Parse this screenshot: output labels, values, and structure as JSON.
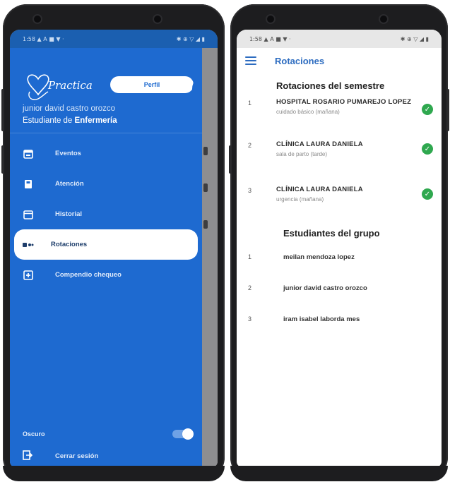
{
  "left_phone": {
    "status": {
      "time": "1:58",
      "icons_left": "▲ A ■ ▼ ·",
      "icons_right": "✱ ⊕ ▽ ◢ ▮"
    },
    "brand": "Practica",
    "profile_button": "Perfil",
    "close_icon": "✕",
    "user": {
      "name": "junior david castro orozco",
      "role_prefix": "Estudiante de",
      "role_area": "Enfermería"
    },
    "menu": [
      {
        "label": "Eventos",
        "icon": "calendar-card-icon"
      },
      {
        "label": "Atención",
        "icon": "clipboard-icon"
      },
      {
        "label": "Historial",
        "icon": "calendar-icon"
      },
      {
        "label": "Rotaciones",
        "icon": "rotation-icon",
        "active": true
      },
      {
        "label": "Compendio chequeo",
        "icon": "plus-square-icon"
      }
    ],
    "dark_mode_label": "Oscuro",
    "logout_label": "Cerrar sesión"
  },
  "right_phone": {
    "status": {
      "time": "1:58",
      "icons_left": "▲ A ■ ▼ ·",
      "icons_right": "✱ ⊕ ▽ ◢ ▮"
    },
    "appbar_title": "Rotaciones",
    "rotations_heading": "Rotaciones del semestre",
    "rotations": [
      {
        "index": "1",
        "name": "HOSPITAL ROSARIO PUMAREJO LOPEZ",
        "detail": "cuidado básico (mañana)",
        "done": true
      },
      {
        "index": "2",
        "name": "CLÍNICA LAURA DANIELA",
        "detail": "sala de parto (tarde)",
        "done": true
      },
      {
        "index": "3",
        "name": "CLÍNICA LAURA DANIELA",
        "detail": "urgencia (mañana)",
        "done": true
      }
    ],
    "students_heading": "Estudiantes del grupo",
    "students": [
      {
        "index": "1",
        "name": "meilan mendoza lopez"
      },
      {
        "index": "2",
        "name": "junior david castro orozco"
      },
      {
        "index": "3",
        "name": "iram isabel laborda mes"
      }
    ]
  },
  "colors": {
    "drawer": "#1e6ad0",
    "accent": "#2d6cc0",
    "check": "#2fa84f"
  }
}
